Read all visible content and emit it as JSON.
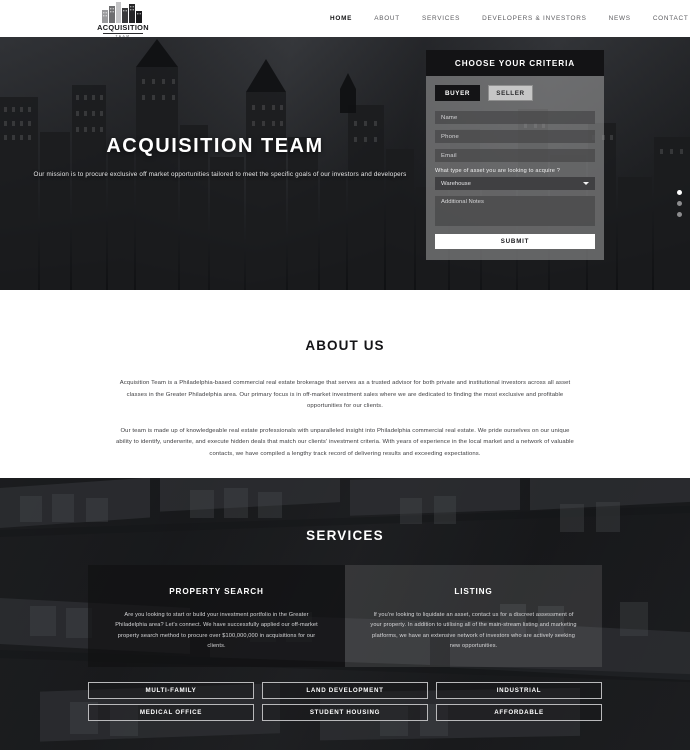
{
  "header": {
    "logo": {
      "icon": "building-skyline-icon",
      "word": "ACQUISITION",
      "sub": "TEAM"
    },
    "nav": [
      {
        "label": "HOME",
        "active": true
      },
      {
        "label": "ABOUT",
        "active": false
      },
      {
        "label": "SERVICES",
        "active": false
      },
      {
        "label": "DEVELOPERS & INVESTORS",
        "active": false
      },
      {
        "label": "NEWS",
        "active": false
      },
      {
        "label": "CONTACT",
        "active": false
      }
    ]
  },
  "hero": {
    "title": "ACQUISITION TEAM",
    "subtitle": "Our mission is to procure exclusive off market opportunities tailored to meet the specific goals of our investors and developers",
    "slider_dots": [
      {
        "active": true
      },
      {
        "active": false
      },
      {
        "active": false
      }
    ]
  },
  "criteria_form": {
    "heading": "CHOOSE YOUR CRITERIA",
    "toggle": {
      "buyer_label": "BUYER",
      "seller_label": "SELLER",
      "selected": "BUYER"
    },
    "fields": {
      "name_placeholder": "Name",
      "phone_placeholder": "Phone",
      "email_placeholder": "Email",
      "asset_question": "What type of asset you are looking to acquire ?",
      "asset_selected": "Warehouse",
      "notes_placeholder": "Additional Notes"
    },
    "submit_label": "SUBMIT"
  },
  "about": {
    "title": "ABOUT US",
    "paragraphs": [
      "Acquisition Team is a Philadelphia-based commercial real estate brokerage that serves as a trusted advisor for both private and institutional investors across all asset classes in the Greater Philadelphia area. Our primary focus is in off-market investment sales where we are dedicated to finding the most exclusive and profitable opportunities for our clients.",
      "Our team is made up of knowledgeable real estate professionals with unparalleled insight into Philadelphia commercial real estate. We pride ourselves on our unique ability to identify, underwrite, and execute hidden deals that match our clients' investment criteria. With years of experience in the local market and a network of valuable contacts, we have compiled a lengthy track record of delivering results and exceeding expectations."
    ]
  },
  "services": {
    "title": "SERVICES",
    "cards": [
      {
        "title": "PROPERTY SEARCH",
        "text": "Are you looking to start or build your investment portfolio in the Greater Philadelphia area? Let's connect. We have successfully applied our off-market property search method to procure over $100,000,000 in acquisitions for our clients."
      },
      {
        "title": "LISTING",
        "text": "If you're looking to liquidate an asset, contact us for a discreet assessment of your property. In addition to utilising all of the main-stream listing and marketing platforms, we have an extensive network of investors who are actively seeking new opportunities."
      }
    ],
    "categories": [
      "MULTI-FAMILY",
      "LAND DEVELOPMENT",
      "INDUSTRIAL",
      "MEDICAL OFFICE",
      "STUDENT HOUSING",
      "AFFORDABLE"
    ]
  },
  "colors": {
    "accent_dark": "#131315",
    "page_bg": "#ffffff",
    "text_dark": "#141417",
    "text_light": "#ffffff"
  }
}
